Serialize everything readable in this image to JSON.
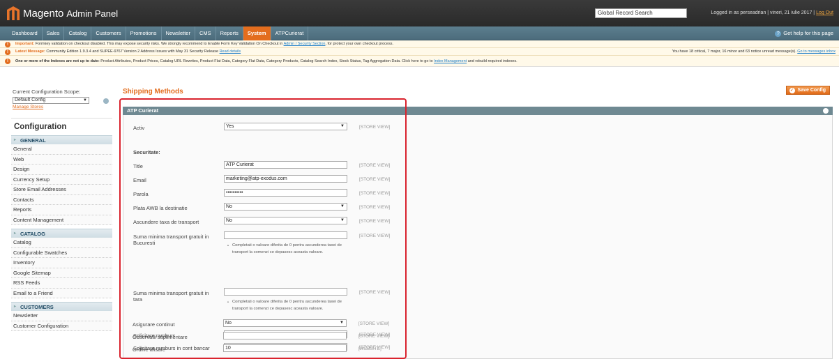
{
  "header": {
    "logo_text": "Magento",
    "logo_sub": "Admin Panel",
    "search_placeholder": "Global Record Search",
    "login_info": "Logged in as perseadrian | vineri, 21 iulie 2017 |",
    "logout_label": "Log Out"
  },
  "nav": {
    "items": [
      "Dashboard",
      "Sales",
      "Catalog",
      "Customers",
      "Promotions",
      "Newsletter",
      "CMS",
      "Reports",
      "System",
      "ATPCurierat"
    ],
    "active": "System",
    "help_label": "Get help for this page"
  },
  "messages": {
    "m1_bold": "Important:",
    "m1_text": "Formkey validation on checkout disabled. This may expose security risks. We strongly recommend to Enable Form Key Validation On Checkout in",
    "m1_link": "Admin / Security Section",
    "m1_tail": ", for protect your own checkout process.",
    "m2_bold": "Latest Message:",
    "m2_text": "Community Edition 1.9.3.4 and SUPEE-9767 Version 2 Address Issues with May 31 Security Release",
    "m2_link": "Read details",
    "m2_right": "You have 18 critical, 7 major, 16 minor and 63 notice unread message(s).",
    "m2_right_link": "Go to messages inbox",
    "m3_bold": "One or more of the Indexes are not up to date:",
    "m3_text": "Product Attributes, Product Prices, Catalog URL Rewrites, Product Flat Data, Category Flat Data, Category Products, Catalog Search Index, Stock Status, Tag Aggregation Data. Click here to go to",
    "m3_link": "Index Management",
    "m3_tail": "and rebuild required indexes."
  },
  "sidebar": {
    "scope_label": "Current Configuration Scope:",
    "scope_value": "Default Config",
    "manage_stores": "Manage Stores",
    "config_title": "Configuration",
    "sections": [
      {
        "title": "GENERAL",
        "items": [
          "General",
          "Web",
          "Design",
          "Currency Setup",
          "Store Email Addresses",
          "Contacts",
          "Reports",
          "Content Management"
        ]
      },
      {
        "title": "CATALOG",
        "items": [
          "Catalog",
          "Configurable Swatches",
          "Inventory",
          "Google Sitemap",
          "RSS Feeds",
          "Email to a Friend"
        ]
      },
      {
        "title": "CUSTOMERS",
        "items": [
          "Newsletter",
          "Customer Configuration"
        ]
      }
    ]
  },
  "main": {
    "title": "Shipping Methods",
    "save_label": "Save Config",
    "fieldset_title": "ATP Curierat",
    "securitate_label": "Securitate:",
    "fields": {
      "activ": {
        "label": "Activ",
        "value": "Yes",
        "scope": "[STORE VIEW]"
      },
      "title": {
        "label": "Title",
        "value": "ATP Curierat",
        "scope": "[STORE VIEW]"
      },
      "email": {
        "label": "Email",
        "value": "marketing@atp-exodus.com",
        "scope": "[STORE VIEW]"
      },
      "parola": {
        "label": "Parola",
        "value": "••••••••••",
        "scope": "[STORE VIEW]"
      },
      "plata": {
        "label": "Plata AWB la destinatie",
        "value": "No",
        "scope": "[STORE VIEW]"
      },
      "ascundere": {
        "label": "Ascundere taxa de transport",
        "value": "No",
        "scope": "[STORE VIEW]"
      },
      "suma_buc": {
        "label": "Suma minima transport gratuit in Bucuresti",
        "value": "",
        "scope": "[STORE VIEW]",
        "note": "Completati o valoare diferita de 0 pentru ascunderea taxei de transport la comenzi ce depasesc aceasta valoare."
      },
      "suma_tara": {
        "label": "Suma minima transport gratuit in tara",
        "value": "",
        "scope": "[STORE VIEW]",
        "note": "Completati o valoare diferita de 0 pentru ascunderea taxei de transport la comenzi ce depasesc aceasta valoare."
      },
      "solicitare": {
        "label": "Solicitare ramburs",
        "value": "No",
        "scope": "[STORE VIEW]"
      },
      "solicitare_cont": {
        "label": "Solicitare ramburs in cont bancar",
        "value": "No",
        "scope": "[STORE VIEW]"
      },
      "asigurare": {
        "label": "Asigurare continut",
        "value": "No",
        "scope": "[STORE VIEW]"
      },
      "observatii": {
        "label": "Observatii suplimentare",
        "value": "",
        "scope": "[STORE VIEW]"
      },
      "ordine": {
        "label": "Ordine afisare",
        "value": "10",
        "scope": "[WEBSITE]"
      }
    }
  }
}
